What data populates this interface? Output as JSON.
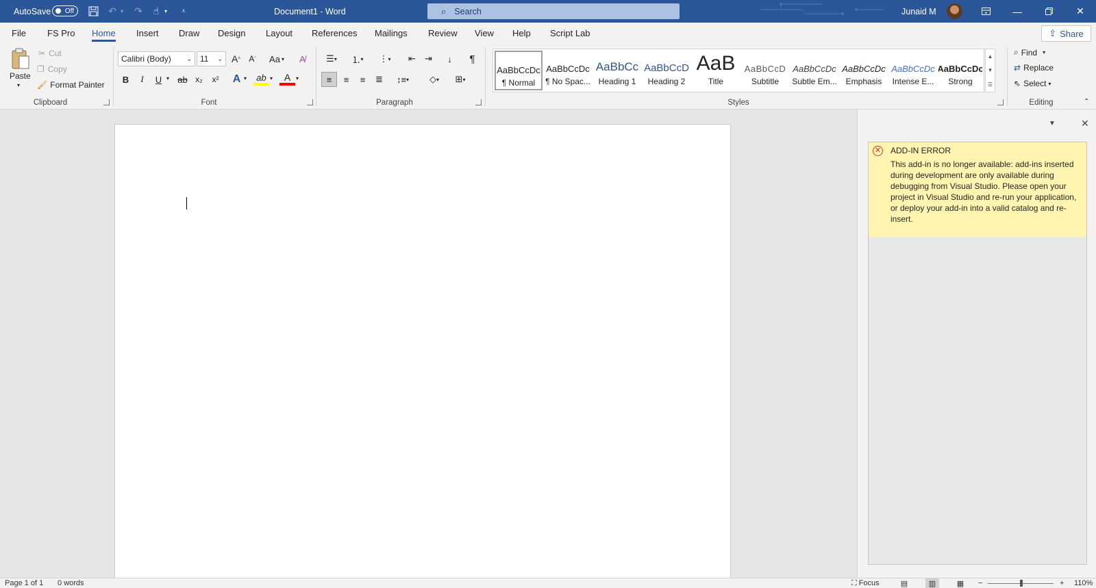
{
  "titlebar": {
    "autosave_label": "AutoSave",
    "autosave_state": "Off",
    "document_title": "Document1  -  Word",
    "search_placeholder": "Search",
    "user_name": "Junaid M",
    "accent_color": "#2b579a"
  },
  "tabs": [
    "File",
    "FS Pro",
    "Home",
    "Insert",
    "Draw",
    "Design",
    "Layout",
    "References",
    "Mailings",
    "Review",
    "View",
    "Help",
    "Script Lab"
  ],
  "active_tab": "Home",
  "share_label": "Share",
  "clipboard": {
    "group_label": "Clipboard",
    "paste": "Paste",
    "cut": "Cut",
    "copy": "Copy",
    "format_painter": "Format Painter"
  },
  "font": {
    "group_label": "Font",
    "font_name": "Calibri (Body)",
    "font_size": "11",
    "change_case": "Aa",
    "bold": "B",
    "italic": "I",
    "underline": "U",
    "strike": "ab",
    "subscript": "x₂",
    "superscript": "x²",
    "text_effects": "A",
    "highlight": "ab",
    "font_color": "A"
  },
  "paragraph": {
    "group_label": "Paragraph"
  },
  "styles": {
    "group_label": "Styles",
    "items": [
      {
        "sample": "AaBbCcDc",
        "name": "¶ Normal"
      },
      {
        "sample": "AaBbCcDc",
        "name": "¶ No Spac..."
      },
      {
        "sample": "AaBbCc",
        "name": "Heading 1"
      },
      {
        "sample": "AaBbCcD",
        "name": "Heading 2"
      },
      {
        "sample": "AaB",
        "name": "Title"
      },
      {
        "sample": "AaBbCcD",
        "name": "Subtitle"
      },
      {
        "sample": "AaBbCcDc",
        "name": "Subtle Em..."
      },
      {
        "sample": "AaBbCcDc",
        "name": "Emphasis"
      },
      {
        "sample": "AaBbCcDc",
        "name": "Intense E..."
      },
      {
        "sample": "AaBbCcDc",
        "name": "Strong"
      }
    ]
  },
  "editing": {
    "group_label": "Editing",
    "find": "Find",
    "replace": "Replace",
    "select": "Select"
  },
  "taskpane": {
    "error_title": "ADD-IN ERROR",
    "error_message": "This add-in is no longer available: add-ins inserted during development are only available during debugging from Visual Studio. Please open your project in Visual Studio and re-run your application, or deploy your add-in into a valid catalog and re-insert.",
    "error_bg": "#fff5b1"
  },
  "statusbar": {
    "page": "Page 1 of 1",
    "words": "0 words",
    "focus": "Focus",
    "zoom": "110%"
  }
}
